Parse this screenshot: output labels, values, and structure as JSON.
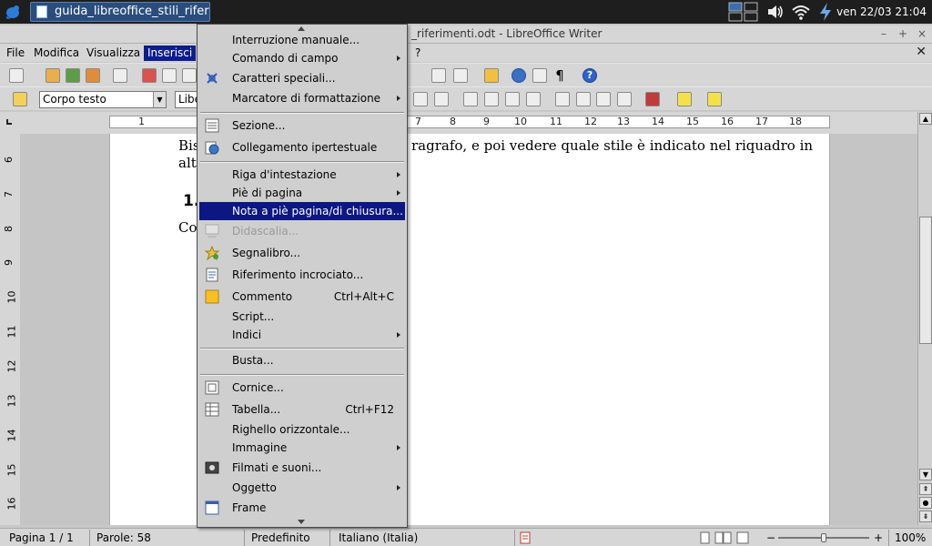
{
  "panel": {
    "task_title": "guida_libreoffice_stili_riferi...",
    "clock": "ven 22/03 21:04"
  },
  "window": {
    "title": "_riferimenti.odt - LibreOffice Writer"
  },
  "menubar": {
    "items": [
      "File",
      "Modifica",
      "Visualizza",
      "Inserisci",
      "?"
    ]
  },
  "toolbar": {
    "paragraph_style": "Corpo testo",
    "font_name": "Libe",
    "formatting_marks": "¶",
    "help_label": "?"
  },
  "ruler": {
    "numbers": [
      "1",
      "7",
      "8",
      "9",
      "10",
      "11",
      "12",
      "13",
      "14",
      "15",
      "16",
      "17",
      "18"
    ]
  },
  "vruler": {
    "numbers": [
      "6",
      "7",
      "8",
      "9",
      "10",
      "11",
      "12",
      "13",
      "14",
      "15",
      "16"
    ]
  },
  "document": {
    "line1_left": "Bis",
    "line1_right": "ragrafo, e poi vedere quale stile è indicato nel riquadro in",
    "line2_left": "alte",
    "heading": "1.",
    "line3_left": "Co"
  },
  "menu": {
    "items": [
      {
        "label": "Interruzione manuale..."
      },
      {
        "label": "Comando di campo",
        "submenu": true
      },
      {
        "label": "Caratteri speciali...",
        "icon": "omega-icon"
      },
      {
        "label": "Marcatore di formattazione",
        "submenu": true
      },
      {
        "label": "Sezione...",
        "icon": "section-icon"
      },
      {
        "label": "Collegamento ipertestuale",
        "icon": "hyperlink-icon"
      },
      {
        "label": "Riga d'intestazione",
        "submenu": true
      },
      {
        "label": "Piè di pagina",
        "submenu": true
      },
      {
        "label": "Nota a piè pagina/di chiusura...",
        "highlighted": true
      },
      {
        "label": "Didascalia...",
        "disabled": true,
        "icon": "caption-icon"
      },
      {
        "label": "Segnalibro...",
        "icon": "bookmark-icon"
      },
      {
        "label": "Riferimento incrociato...",
        "icon": "cross-reference-icon"
      },
      {
        "label": "Commento",
        "accelerator": "Ctrl+Alt+C",
        "icon": "comment-icon"
      },
      {
        "label": "Script..."
      },
      {
        "label": "Indici",
        "submenu": true
      },
      {
        "label": "Busta..."
      },
      {
        "label": "Cornice...",
        "icon": "frame-icon"
      },
      {
        "label": "Tabella...",
        "accelerator": "Ctrl+F12",
        "icon": "table-icon"
      },
      {
        "label": "Righello orizzontale..."
      },
      {
        "label": "Immagine",
        "submenu": true
      },
      {
        "label": "Filmati e suoni...",
        "icon": "movie-icon"
      },
      {
        "label": "Oggetto",
        "submenu": true
      },
      {
        "label": "Frame",
        "icon": "floating-frame-icon"
      }
    ]
  },
  "statusbar": {
    "page": "Pagina 1 / 1",
    "words": "Parole: 58",
    "style": "Predefinito",
    "language": "Italiano (Italia)",
    "zoom": "100%"
  }
}
